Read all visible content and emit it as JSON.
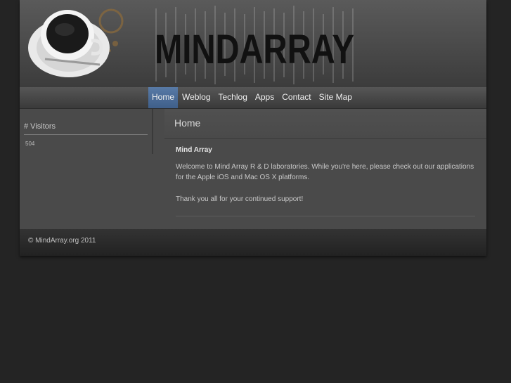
{
  "site": {
    "logo_text": "MINDARRAY"
  },
  "nav": {
    "items": [
      {
        "label": "Home",
        "active": true
      },
      {
        "label": "Weblog",
        "active": false
      },
      {
        "label": "Techlog",
        "active": false
      },
      {
        "label": "Apps",
        "active": false
      },
      {
        "label": "Contact",
        "active": false
      },
      {
        "label": "Site Map",
        "active": false
      }
    ]
  },
  "sidebar": {
    "visitors_title": "# Visitors",
    "visitors_count": "504"
  },
  "main": {
    "page_title": "Home",
    "heading": "Mind Array",
    "paragraph1": "Welcome to Mind Array R & D laboratories. While you're here, please check out our applications for the Apple iOS and Mac OS X platforms.",
    "paragraph2": "Thank you all for your continued support!"
  },
  "footer": {
    "copyright": "© MindArray.org 2011"
  },
  "colors": {
    "background": "#242424",
    "panel": "#4a4a4a",
    "nav_active": "#4a6c98"
  }
}
